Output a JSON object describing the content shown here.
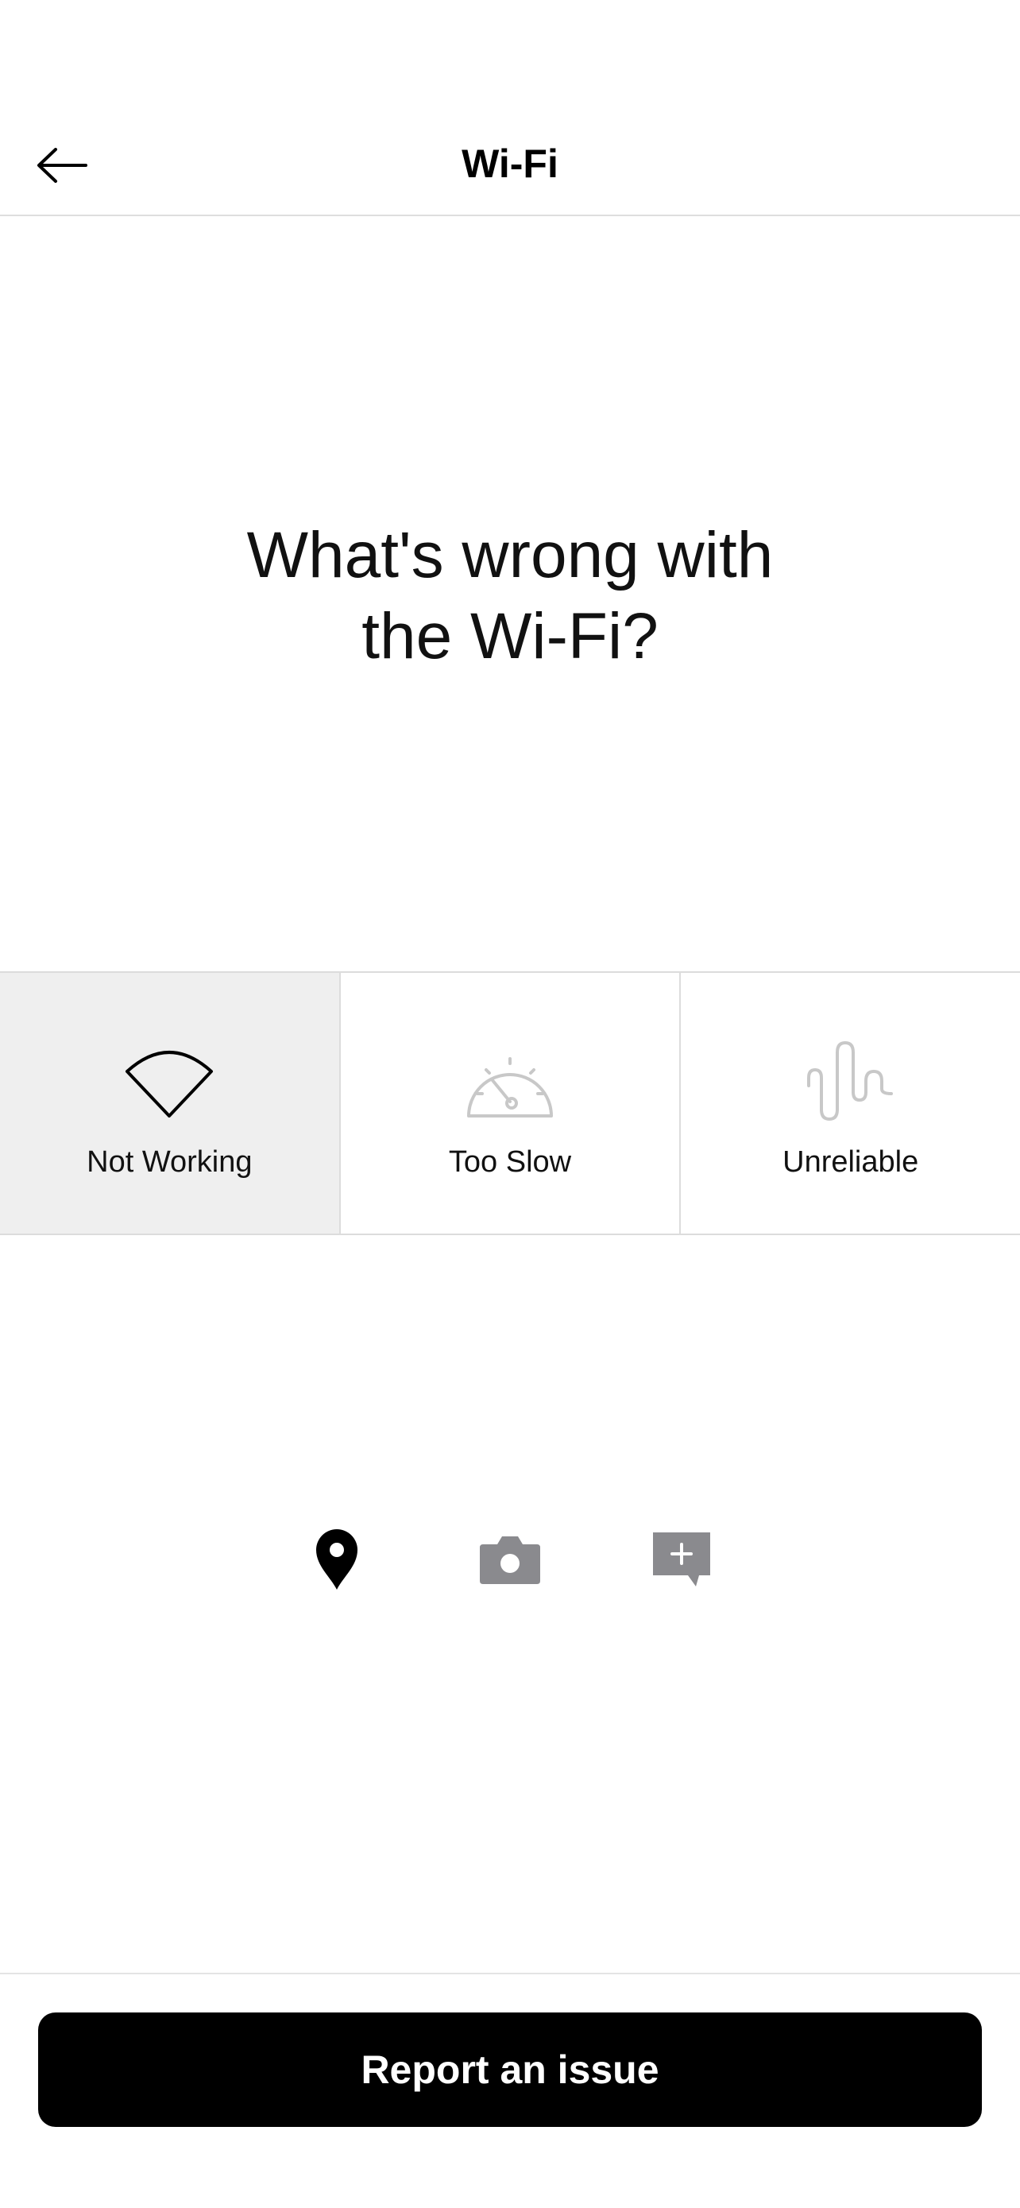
{
  "header": {
    "title": "Wi-Fi",
    "back_icon": "arrow-left-icon"
  },
  "question": {
    "line1": "What's wrong with",
    "line2": "the Wi-Fi?"
  },
  "options": [
    {
      "label": "Not Working",
      "icon": "wifi-icon",
      "selected": true
    },
    {
      "label": "Too Slow",
      "icon": "speedometer-icon",
      "selected": false
    },
    {
      "label": "Unreliable",
      "icon": "signal-wave-icon",
      "selected": false
    }
  ],
  "attachments": [
    {
      "icon": "location-pin-icon",
      "color": "#000000"
    },
    {
      "icon": "camera-icon",
      "color": "#8a8a8e"
    },
    {
      "icon": "add-comment-icon",
      "color": "#8a8a8e"
    }
  ],
  "footer": {
    "report_label": "Report an issue"
  },
  "colors": {
    "selected_bg": "#efefef",
    "button_bg": "#000000",
    "button_text": "#ffffff",
    "inactive_icon": "#8a8a8e",
    "divider": "#dcdcdc"
  }
}
